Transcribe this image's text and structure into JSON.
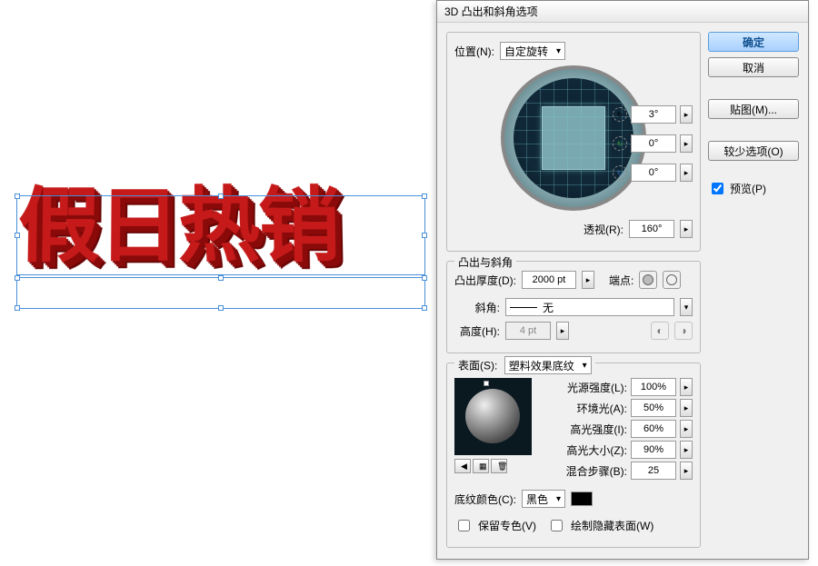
{
  "canvas_text": "假日热销",
  "dialog": {
    "title": "3D 凸出和斜角选项",
    "position": {
      "label": "位置(N):",
      "value": "自定旋转",
      "rotX": "3°",
      "rotY": "0°",
      "rotZ": "0°",
      "perspective_label": "透视(R):",
      "perspective_value": "160°"
    },
    "extrude": {
      "group_label": "凸出与斜角",
      "depth_label": "凸出厚度(D):",
      "depth_value": "2000 pt",
      "cap_label": "端点:",
      "bevel_label": "斜角:",
      "bevel_value": "无",
      "height_label": "高度(H):",
      "height_value": "4 pt"
    },
    "surface": {
      "group_label": "表面(S):",
      "value": "塑料效果底纹",
      "light_intensity": {
        "label": "光源强度(L):",
        "value": "100%"
      },
      "ambient": {
        "label": "环境光(A):",
        "value": "50%"
      },
      "highlight_intensity": {
        "label": "高光强度(I):",
        "value": "60%"
      },
      "highlight_size": {
        "label": "高光大小(Z):",
        "value": "90%"
      },
      "blend_steps": {
        "label": "混合步骤(B):",
        "value": "25"
      },
      "shade_color_label": "底纹颜色(C):",
      "shade_color_value": "黑色",
      "preserve_spot": "保留专色(V)",
      "draw_hidden": "绘制隐藏表面(W)"
    },
    "buttons": {
      "ok": "确定",
      "cancel": "取消",
      "map": "贴图(M)...",
      "fewer": "较少选项(O)",
      "preview": "预览(P)"
    }
  }
}
